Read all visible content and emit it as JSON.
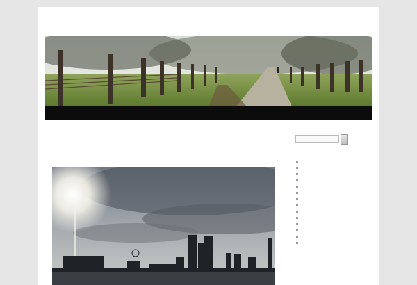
{
  "site": {
    "title": ""
  },
  "nav": {
    "items": [
      {
        "label": ""
      }
    ]
  },
  "main": {
    "category_heading": "",
    "post_title": ""
  },
  "sidebar": {
    "search": {
      "value": "",
      "button_label": ""
    },
    "widget_title": "",
    "links": [
      {
        "label": ""
      },
      {
        "label": ""
      },
      {
        "label": ""
      },
      {
        "label": ""
      },
      {
        "label": ""
      },
      {
        "label": ""
      },
      {
        "label": ""
      },
      {
        "label": ""
      },
      {
        "label": ""
      },
      {
        "label": ""
      },
      {
        "label": ""
      },
      {
        "label": ""
      },
      {
        "label": ""
      },
      {
        "label": ""
      }
    ]
  },
  "colors": {
    "page_background": "#e6e6e6",
    "content_background": "#ffffff",
    "nav_background": "#0c0c0c",
    "link": "#1a55a8"
  }
}
